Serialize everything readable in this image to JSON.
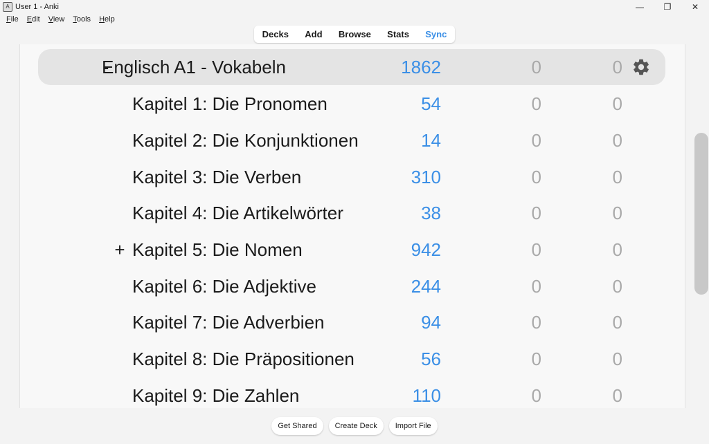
{
  "window": {
    "title": "User 1 - Anki",
    "minimize_glyph": "—",
    "restore_glyph": "❐",
    "close_glyph": "✕"
  },
  "menu": [
    "File",
    "Edit",
    "View",
    "Tools",
    "Help"
  ],
  "toolbar": {
    "decks": "Decks",
    "add": "Add",
    "browse": "Browse",
    "stats": "Stats",
    "sync": "Sync"
  },
  "decks": [
    {
      "collapse": "-",
      "name": "Englisch A1 - Vokabeln",
      "new": "1862",
      "learn": "0",
      "due": "0"
    },
    {
      "collapse": "",
      "name": "Kapitel 1: Die Pronomen",
      "new": "54",
      "learn": "0",
      "due": "0"
    },
    {
      "collapse": "",
      "name": "Kapitel 2: Die Konjunktionen",
      "new": "14",
      "learn": "0",
      "due": "0"
    },
    {
      "collapse": "",
      "name": "Kapitel 3: Die Verben",
      "new": "310",
      "learn": "0",
      "due": "0"
    },
    {
      "collapse": "",
      "name": "Kapitel 4: Die Artikelwörter",
      "new": "38",
      "learn": "0",
      "due": "0"
    },
    {
      "collapse": "+",
      "name": "Kapitel 5: Die Nomen",
      "new": "942",
      "learn": "0",
      "due": "0"
    },
    {
      "collapse": "",
      "name": "Kapitel 6: Die Adjektive",
      "new": "244",
      "learn": "0",
      "due": "0"
    },
    {
      "collapse": "",
      "name": "Kapitel 7: Die Adverbien",
      "new": "94",
      "learn": "0",
      "due": "0"
    },
    {
      "collapse": "",
      "name": "Kapitel 8: Die Präpositionen",
      "new": "56",
      "learn": "0",
      "due": "0"
    },
    {
      "collapse": "",
      "name": "Kapitel 9: Die Zahlen",
      "new": "110",
      "learn": "0",
      "due": "0"
    }
  ],
  "bottom": {
    "get_shared": "Get Shared",
    "create_deck": "Create Deck",
    "import_file": "Import File"
  },
  "colors": {
    "new_count": "#3b8fe6",
    "zero_count": "#a9a9a9",
    "current_row": "#e4e4e4"
  },
  "icons": {
    "deck_options": "gear-icon"
  }
}
